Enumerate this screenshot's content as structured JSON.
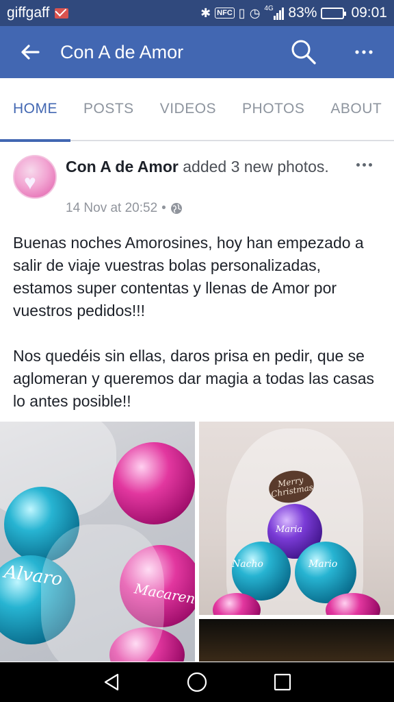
{
  "status_bar": {
    "carrier": "giffgaff",
    "battery_percent": "83%",
    "time": "09:01",
    "network": "4G",
    "icons": [
      "mail-icon",
      "bluetooth-icon",
      "nfc-icon",
      "vibrate-icon",
      "alarm-icon",
      "signal-icon",
      "battery-icon"
    ],
    "nfc_label": "NFC"
  },
  "app_bar": {
    "title": "Con A de Amor",
    "back_icon": "back-arrow-icon",
    "search_icon": "search-icon",
    "more_icon": "more-icon"
  },
  "tabs": [
    {
      "label": "HOME",
      "active": true
    },
    {
      "label": "POSTS",
      "active": false
    },
    {
      "label": "VIDEOS",
      "active": false
    },
    {
      "label": "PHOTOS",
      "active": false
    },
    {
      "label": "ABOUT",
      "active": false
    }
  ],
  "post": {
    "author": "Con A de Amor",
    "action": " added 3 new photos.",
    "timestamp": "14 Nov at 20:52",
    "separator": "•",
    "privacy_icon": "globe-icon",
    "paragraphs": [
      "Buenas noches Amorosines, hoy han empezado a salir de viaje vuestras bolas personalizadas, estamos super contentas y llenas de Amor por vuestros pedidos!!!",
      "Nos quedéis sin ellas, daros prisa en pedir, que se aglomeran y queremos dar magia a todas las casas lo antes posible!!"
    ],
    "photos": {
      "photo1_names": [
        "Alvaro",
        "Macarena"
      ],
      "photo2_tag": "Merry Christmas",
      "photo2_names": [
        "Nacho",
        "Mario",
        "Maria"
      ]
    }
  },
  "nav_bar": {
    "icons": [
      "back-nav-icon",
      "home-nav-icon",
      "recents-nav-icon"
    ]
  },
  "colors": {
    "status_bar": "#30497d",
    "app_bar": "#4267b2",
    "tab_active": "#4267b2",
    "tab_inactive": "#8d949e"
  }
}
